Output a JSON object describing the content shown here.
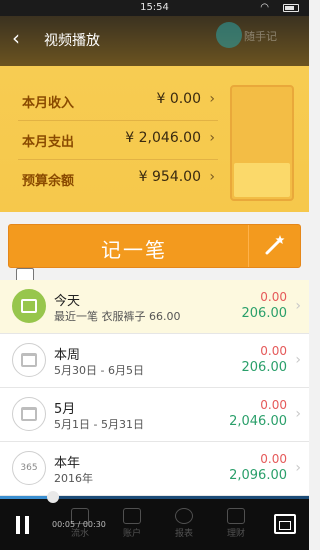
{
  "status_bar": {
    "time": "15:54"
  },
  "video_overlay": {
    "title": "视频播放",
    "ghost_text": "随手记"
  },
  "summary": [
    {
      "label": "本月收入",
      "value": "¥ 0.00"
    },
    {
      "label": "本月支出",
      "value": "¥ 2,046.00"
    },
    {
      "label": "预算余额",
      "value": "¥ 954.00"
    }
  ],
  "record_button": {
    "label": "记一笔"
  },
  "list": [
    {
      "title": "今天",
      "sub": "最近一笔 衣服裤子 66.00",
      "expense": "0.00",
      "income": "206.00"
    },
    {
      "title": "本周",
      "sub": "5月30日 - 6月5日",
      "expense": "0.00",
      "income": "206.00"
    },
    {
      "title": "5月",
      "sub": "5月1日 - 5月31日",
      "expense": "0.00",
      "income": "2,046.00"
    },
    {
      "title": "本年",
      "sub": "2016年",
      "expense": "0.00",
      "income": "2,096.00"
    }
  ],
  "year_icon_label": "365",
  "player": {
    "timecode": "00:05 / 00:30",
    "progress": 0.17
  },
  "bottom_tabs": [
    "流水",
    "账户",
    "报表",
    "理财"
  ],
  "colors": {
    "accent": "#f39a1e",
    "income": "#2a9f6a",
    "expense": "#e55a5a",
    "banner": "#f7cc52"
  }
}
